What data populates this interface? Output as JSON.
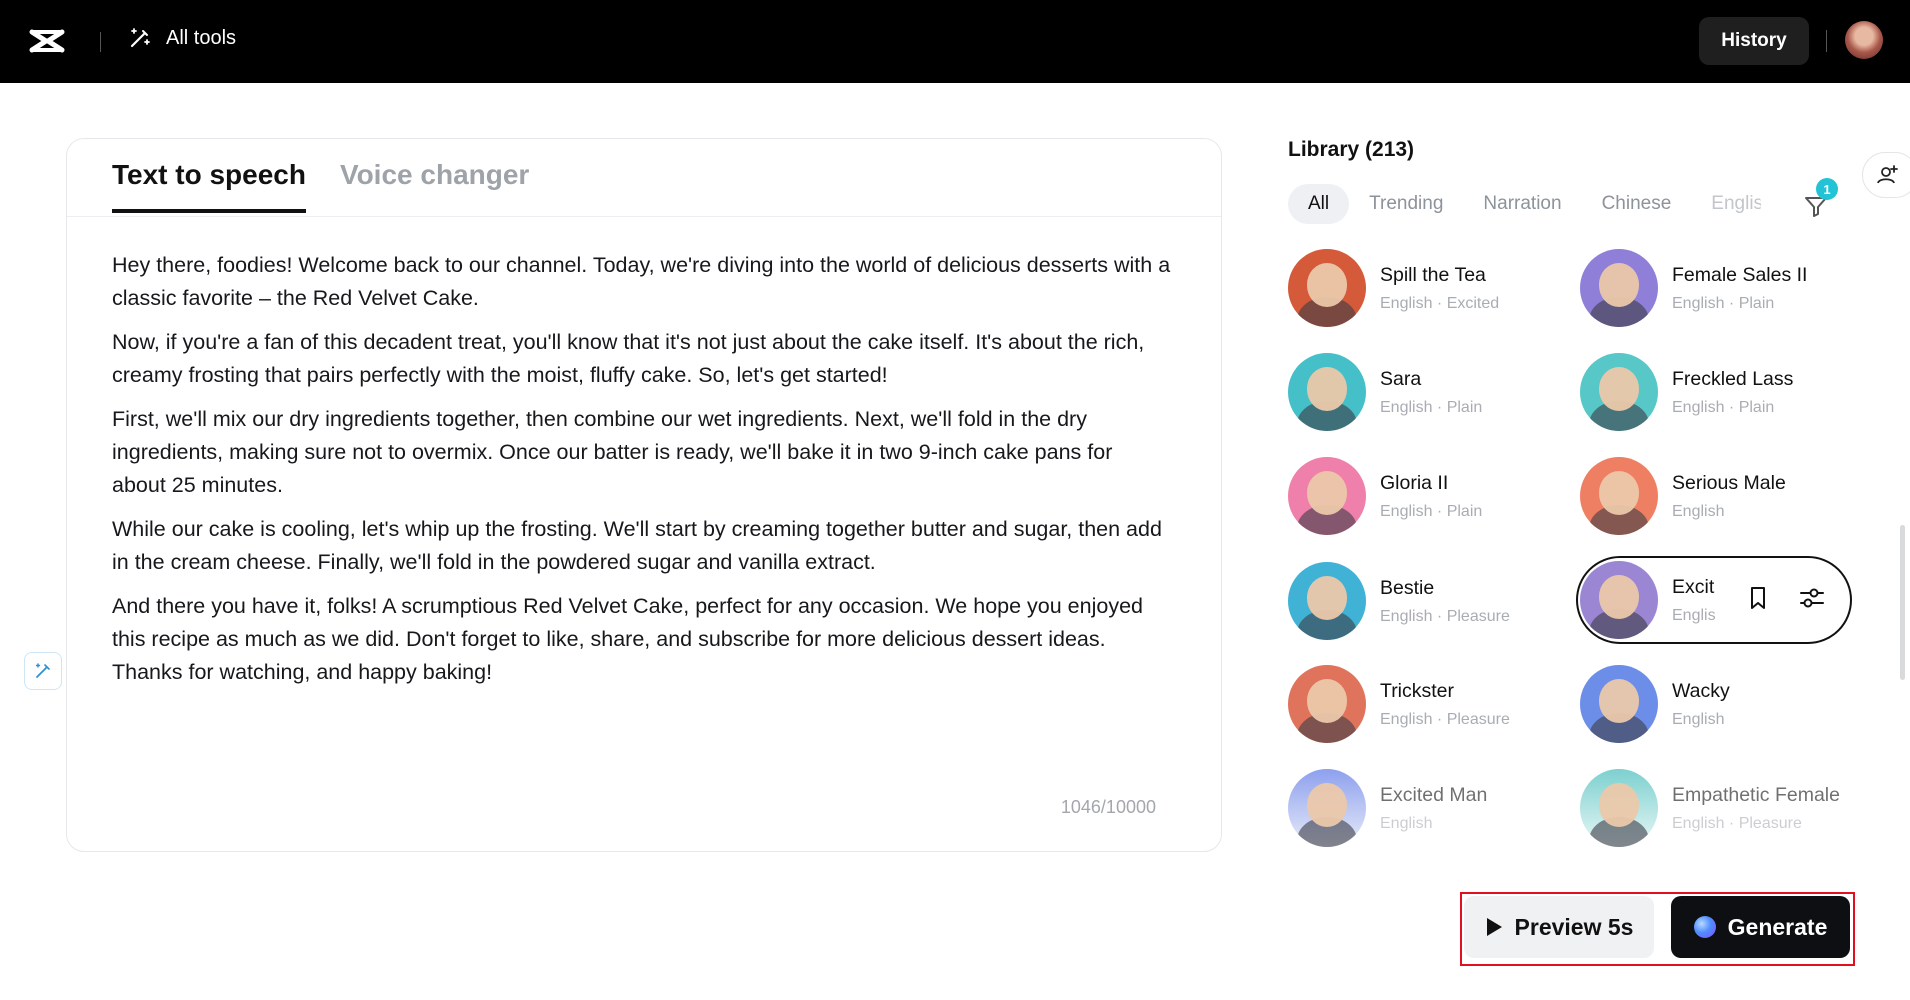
{
  "topbar": {
    "all_tools_label": "All tools",
    "history_label": "History"
  },
  "editor": {
    "tabs": [
      {
        "label": "Text to speech",
        "active": true
      },
      {
        "label": "Voice changer",
        "active": false
      }
    ],
    "paragraphs": [
      "Hey there, foodies! Welcome back to our channel. Today, we're diving into the world of delicious desserts with a classic favorite – the Red Velvet Cake.",
      "Now, if you're a fan of this decadent treat, you'll know that it's not just about the cake itself. It's about the rich, creamy frosting that pairs perfectly with the moist, fluffy cake. So, let's get started!",
      "First, we'll mix our dry ingredients together, then combine our wet ingredients. Next, we'll fold in the dry ingredients, making sure not to overmix. Once our batter is ready, we'll bake it in two 9-inch cake pans for about 25 minutes.",
      "While our cake is cooling, let's whip up the frosting. We'll start by creaming together butter and sugar, then add in the cream cheese. Finally, we'll fold in the powdered sugar and vanilla extract.",
      "And there you have it, folks! A scrumptious Red Velvet Cake, perfect for any occasion. We hope you enjoyed this recipe as much as we did. Don't forget to like, share, and subscribe for more delicious dessert ideas. Thanks for watching, and happy baking!"
    ],
    "char_count": "1046/10000"
  },
  "library": {
    "title": "Library (213)",
    "filters": [
      "All",
      "Trending",
      "Narration",
      "Chinese",
      "Englis"
    ],
    "active_filter": "All",
    "filter_badge": "1",
    "voices": [
      {
        "name": "Spill the Tea",
        "meta": "English · Excited"
      },
      {
        "name": "Female Sales II",
        "meta": "English · Plain"
      },
      {
        "name": "Sara",
        "meta": "English · Plain"
      },
      {
        "name": "Freckled Lass",
        "meta": "English · Plain"
      },
      {
        "name": "Gloria II",
        "meta": "English · Plain"
      },
      {
        "name": "Serious Male",
        "meta": "English"
      },
      {
        "name": "Bestie",
        "meta": "English · Pleasure"
      },
      {
        "name": "Excit",
        "meta": "Englis"
      },
      {
        "name": "Trickster",
        "meta": "English · Pleasure"
      },
      {
        "name": "Wacky",
        "meta": "English"
      },
      {
        "name": "Excited Man",
        "meta": "English"
      },
      {
        "name": "Empathetic Female",
        "meta": "English · Pleasure"
      }
    ]
  },
  "actions": {
    "preview_label": "Preview 5s",
    "generate_label": "Generate"
  },
  "colors": {
    "accent_badge": "#22c3d6",
    "highlight_box": "#e0101e"
  }
}
